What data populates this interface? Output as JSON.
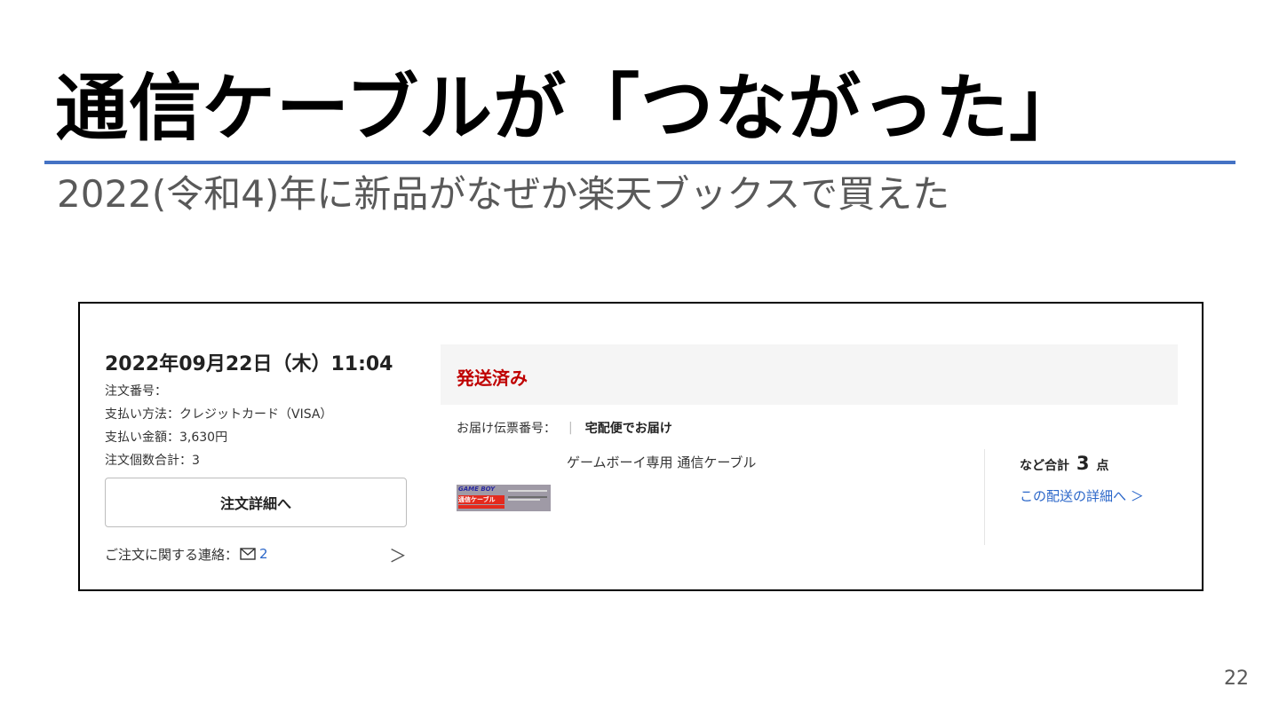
{
  "slide": {
    "title": "通信ケーブルが「つながった」",
    "subtitle": "2022(令和4)年に新品がなぜか楽天ブックスで買えた",
    "page_number": "22"
  },
  "colors": {
    "rule": "#4472c4",
    "status": "#bf0000",
    "link": "#2a66c9"
  },
  "order": {
    "date": "2022年09月22日（木）11:04",
    "order_number": "注文番号：",
    "payment_method": "支払い方法：クレジットカード（VISA）",
    "payment_amount": "支払い金額：3,630円",
    "item_count": "注文個数合計：3",
    "detail_button": "注文詳細へ",
    "contact_label": "ご注文に関する連絡：",
    "contact_icon": "mail-icon",
    "contact_count": "2",
    "contact_chevron": "＞"
  },
  "shipment": {
    "status": "発送済み",
    "tracking_label": "お届け伝票番号：",
    "separator": "|",
    "delivery_method": "宅配便でお届け",
    "product_name": "ゲームボーイ専用 通信ケーブル",
    "thumbnail": {
      "logo": "GAME BOY",
      "label": "通信ケーブル"
    },
    "summary_prefix": "など合計",
    "summary_count": "3",
    "summary_suffix": "点",
    "detail_link": "この配送の詳細へ ＞"
  }
}
